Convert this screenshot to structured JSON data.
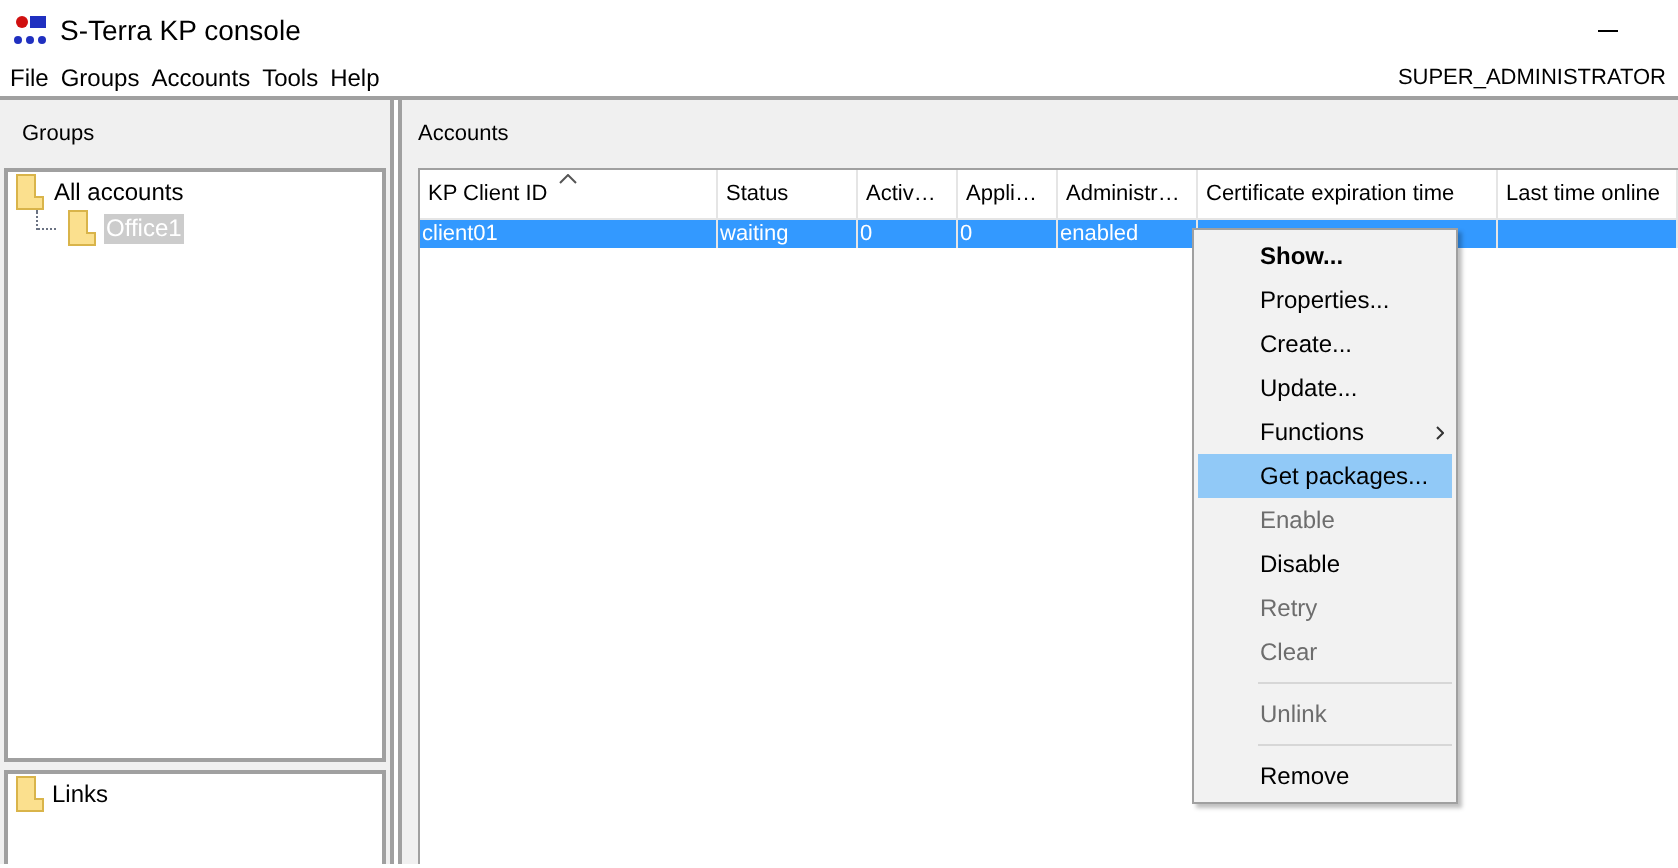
{
  "window": {
    "title": "S-Terra KP console"
  },
  "menu_bar": [
    "File",
    "Groups",
    "Accounts",
    "Tools",
    "Help"
  ],
  "user": "SUPER_ADMINISTRATOR",
  "groups_panel": {
    "title": "Groups",
    "tree": [
      {
        "label": "All accounts",
        "selected": false,
        "children": [
          {
            "label": "Office1",
            "selected": true
          }
        ]
      }
    ]
  },
  "links_panel": {
    "items": [
      {
        "label": "Links"
      }
    ]
  },
  "accounts_panel": {
    "title": "Accounts",
    "table": {
      "columns": [
        {
          "label": "KP Client ID",
          "sorted": true
        },
        {
          "label": "Status",
          "sorted": false
        },
        {
          "label": "Activ…",
          "sorted": false
        },
        {
          "label": "Appli…",
          "sorted": false
        },
        {
          "label": "Administr…",
          "sorted": false
        },
        {
          "label": "Certificate expiration time",
          "sorted": false
        },
        {
          "label": "Last time online",
          "sorted": false
        }
      ],
      "rows": [
        {
          "selected": true,
          "cells": [
            "client01",
            "waiting",
            "0",
            "0",
            "enabled",
            "",
            ""
          ]
        }
      ]
    }
  },
  "context_menu": [
    {
      "kind": "item",
      "label": "Show...",
      "bold": true,
      "disabled": false,
      "highlighted": false,
      "submenu": false
    },
    {
      "kind": "item",
      "label": "Properties...",
      "bold": false,
      "disabled": false,
      "highlighted": false,
      "submenu": false
    },
    {
      "kind": "item",
      "label": "Create...",
      "bold": false,
      "disabled": false,
      "highlighted": false,
      "submenu": false
    },
    {
      "kind": "item",
      "label": "Update...",
      "bold": false,
      "disabled": false,
      "highlighted": false,
      "submenu": false
    },
    {
      "kind": "item",
      "label": "Functions",
      "bold": false,
      "disabled": false,
      "highlighted": false,
      "submenu": true
    },
    {
      "kind": "item",
      "label": "Get packages...",
      "bold": false,
      "disabled": false,
      "highlighted": true,
      "submenu": false
    },
    {
      "kind": "item",
      "label": "Enable",
      "bold": false,
      "disabled": true,
      "highlighted": false,
      "submenu": false
    },
    {
      "kind": "item",
      "label": "Disable",
      "bold": false,
      "disabled": false,
      "highlighted": false,
      "submenu": false
    },
    {
      "kind": "item",
      "label": "Retry",
      "bold": false,
      "disabled": true,
      "highlighted": false,
      "submenu": false
    },
    {
      "kind": "item",
      "label": "Clear",
      "bold": false,
      "disabled": true,
      "highlighted": false,
      "submenu": false
    },
    {
      "kind": "separator"
    },
    {
      "kind": "item",
      "label": "Unlink",
      "bold": false,
      "disabled": true,
      "highlighted": false,
      "submenu": false
    },
    {
      "kind": "separator"
    },
    {
      "kind": "item",
      "label": "Remove",
      "bold": false,
      "disabled": false,
      "highlighted": false,
      "submenu": false
    }
  ]
}
